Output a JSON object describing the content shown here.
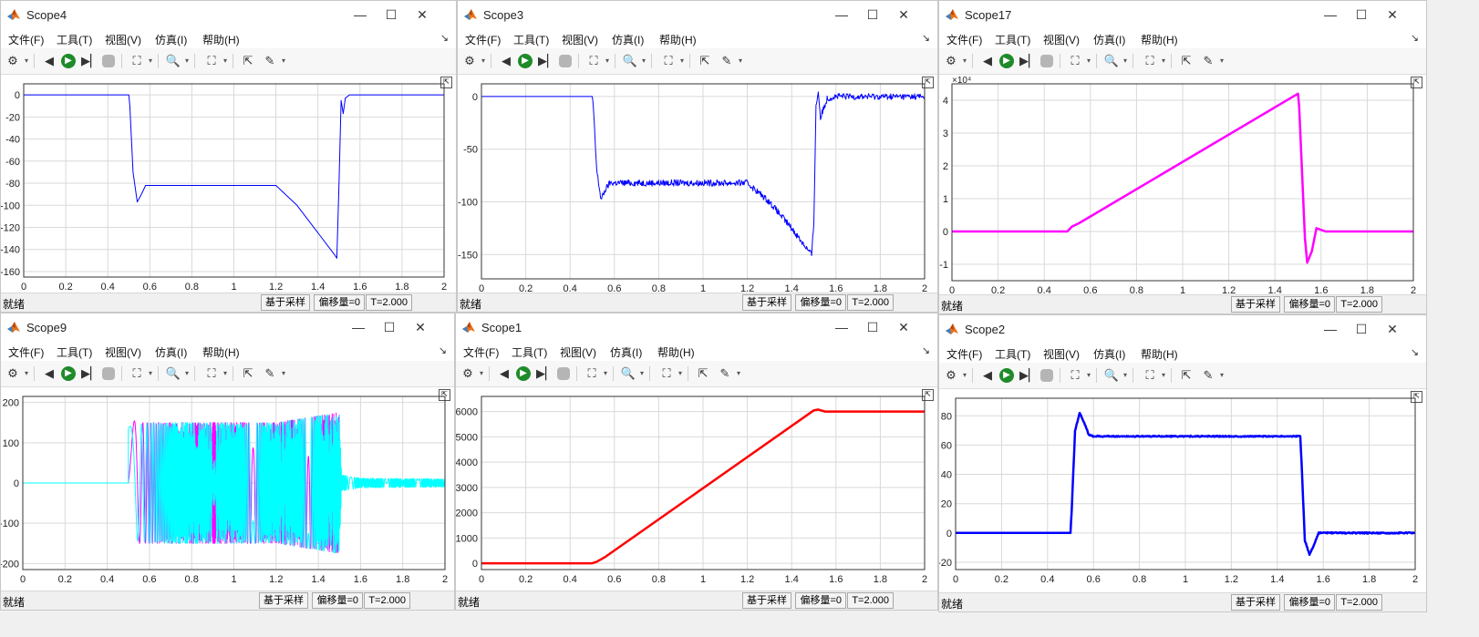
{
  "menu": [
    "文件(F)",
    "工具(T)",
    "视图(V)",
    "仿真(I)",
    "帮助(H)"
  ],
  "status": {
    "ready": "就绪",
    "mode": "基于采样",
    "offset": "偏移量=0",
    "time": "T=2.000"
  },
  "windows": [
    {
      "id": "scope4",
      "title": "Scope4",
      "chart_data": {
        "type": "line",
        "xlim": [
          0,
          2
        ],
        "ylim": [
          -165,
          10
        ],
        "xticks": [
          "0",
          "0.2",
          "0.4",
          "0.6",
          "0.8",
          "1",
          "1.2",
          "1.4",
          "1.6",
          "1.8",
          "2"
        ],
        "yticks": [
          {
            "v": 0,
            "l": "0"
          },
          {
            "v": -20,
            "l": "-20"
          },
          {
            "v": -40,
            "l": "-40"
          },
          {
            "v": -60,
            "l": "-60"
          },
          {
            "v": -80,
            "l": "-80"
          },
          {
            "v": -100,
            "l": "-100"
          },
          {
            "v": -120,
            "l": "-120"
          },
          {
            "v": -140,
            "l": "-140"
          },
          {
            "v": -160,
            "l": "-160"
          }
        ],
        "exponent": "",
        "grid": true,
        "series": [
          {
            "color": "#0000ff",
            "width": 1,
            "noise": 0,
            "x": [
              0,
              0.5,
              0.505,
              0.52,
              0.54,
              0.56,
              0.58,
              0.6,
              1.2,
              1.3,
              1.4,
              1.48,
              1.49,
              1.5,
              1.51,
              1.52,
              1.53,
              1.55,
              1.6,
              2.0
            ],
            "y": [
              0,
              0,
              -10,
              -70,
              -97,
              -90,
              -82,
              -82,
              -82,
              -100,
              -125,
              -145,
              -148,
              -80,
              -5,
              -17,
              -3,
              0,
              0,
              0
            ]
          }
        ]
      }
    },
    {
      "id": "scope3",
      "title": "Scope3",
      "chart_data": {
        "type": "line",
        "xlim": [
          0,
          2
        ],
        "ylim": [
          -173,
          12
        ],
        "xticks": [
          "0",
          "0.2",
          "0.4",
          "0.6",
          "0.8",
          "1",
          "1.2",
          "1.4",
          "1.6",
          "1.8",
          "2"
        ],
        "yticks": [
          {
            "v": 0,
            "l": "0"
          },
          {
            "v": -50,
            "l": "-50"
          },
          {
            "v": -100,
            "l": "-100"
          },
          {
            "v": -150,
            "l": "-150"
          }
        ],
        "exponent": "",
        "grid": true,
        "series": [
          {
            "color": "#0000ff",
            "width": 1,
            "noise": 3,
            "x": [
              0,
              0.5,
              0.505,
              0.52,
              0.54,
              0.56,
              0.58,
              0.6,
              1.2,
              1.3,
              1.4,
              1.49,
              1.5,
              1.51,
              1.52,
              1.53,
              1.56,
              1.6,
              2.0
            ],
            "y": [
              0,
              0,
              -10,
              -70,
              -98,
              -88,
              -82,
              -82,
              -82,
              -100,
              -125,
              -150,
              -120,
              -10,
              5,
              -20,
              -2,
              0,
              0
            ]
          }
        ]
      }
    },
    {
      "id": "scope17",
      "title": "Scope17",
      "chart_data": {
        "type": "line",
        "xlim": [
          0,
          2
        ],
        "ylim": [
          -1.5,
          4.5
        ],
        "xticks": [
          "0",
          "0.2",
          "0.4",
          "0.6",
          "0.8",
          "1",
          "1.2",
          "1.4",
          "1.6",
          "1.8",
          "2"
        ],
        "yticks": [
          {
            "v": 4,
            "l": "4"
          },
          {
            "v": 3,
            "l": "3"
          },
          {
            "v": 2,
            "l": "2"
          },
          {
            "v": 1,
            "l": "1"
          },
          {
            "v": 0,
            "l": "0"
          },
          {
            "v": -1,
            "l": "-1"
          }
        ],
        "exponent": "×10⁴",
        "grid": true,
        "series": [
          {
            "color": "#ff00ff",
            "width": 2.5,
            "noise": 0,
            "x": [
              0,
              0.5,
              0.52,
              0.55,
              1.5,
              1.505,
              1.53,
              1.54,
              1.56,
              1.58,
              1.62,
              2.0
            ],
            "y": [
              0,
              0,
              0.15,
              0.25,
              4.2,
              3.8,
              -0.2,
              -0.95,
              -0.6,
              0.1,
              0,
              0
            ]
          }
        ]
      }
    },
    {
      "id": "scope9",
      "title": "Scope9",
      "chart_data": {
        "type": "line",
        "xlim": [
          0,
          2
        ],
        "ylim": [
          -215,
          215
        ],
        "xticks": [
          "0",
          "0.2",
          "0.4",
          "0.6",
          "0.8",
          "1",
          "1.2",
          "1.4",
          "1.6",
          "1.8",
          "2"
        ],
        "yticks": [
          {
            "v": 200,
            "l": "200"
          },
          {
            "v": 100,
            "l": "100"
          },
          {
            "v": 0,
            "l": "0"
          },
          {
            "v": -100,
            "l": "-100"
          },
          {
            "v": -200,
            "l": "-200"
          }
        ],
        "exponent": "",
        "grid": true,
        "series": [
          {
            "color": "#ff00ff",
            "width": 1,
            "oscillation": true,
            "x0": 0.5,
            "x1": 1.5,
            "amp": [
              [
                0.5,
                160
              ],
              [
                0.55,
                150
              ],
              [
                1.2,
                150
              ],
              [
                1.5,
                175
              ]
            ]
          },
          {
            "color": "#00ffff",
            "width": 1,
            "oscillation": true,
            "x0": 0.5,
            "x1": 2.0,
            "amp": [
              [
                0.5,
                140
              ],
              [
                0.6,
                150
              ],
              [
                1.2,
                150
              ],
              [
                1.5,
                175
              ],
              [
                1.51,
                20
              ],
              [
                1.6,
                12
              ],
              [
                2.0,
                10
              ]
            ]
          }
        ]
      }
    },
    {
      "id": "scope1",
      "title": "Scope1",
      "chart_data": {
        "type": "line",
        "xlim": [
          0,
          2
        ],
        "ylim": [
          -250,
          6600
        ],
        "xticks": [
          "0",
          "0.2",
          "0.4",
          "0.6",
          "0.8",
          "1",
          "1.2",
          "1.4",
          "1.6",
          "1.8",
          "2"
        ],
        "yticks": [
          {
            "v": 6000,
            "l": "6000"
          },
          {
            "v": 5000,
            "l": "5000"
          },
          {
            "v": 4000,
            "l": "4000"
          },
          {
            "v": 3000,
            "l": "3000"
          },
          {
            "v": 2000,
            "l": "2000"
          },
          {
            "v": 1000,
            "l": "1000"
          },
          {
            "v": 0,
            "l": "0"
          }
        ],
        "exponent": "",
        "grid": true,
        "series": [
          {
            "color": "#ff0000",
            "width": 2.5,
            "noise": 0,
            "x": [
              0,
              0.5,
              0.52,
              0.56,
              1.5,
              1.52,
              1.55,
              2.0
            ],
            "y": [
              0,
              0,
              60,
              260,
              6050,
              6080,
              6000,
              6000
            ]
          }
        ]
      }
    },
    {
      "id": "scope2",
      "title": "Scope2",
      "chart_data": {
        "type": "line",
        "xlim": [
          0,
          2
        ],
        "ylim": [
          -25,
          92
        ],
        "xticks": [
          "0",
          "0.2",
          "0.4",
          "0.6",
          "0.8",
          "1",
          "1.2",
          "1.4",
          "1.6",
          "1.8",
          "2"
        ],
        "yticks": [
          {
            "v": 80,
            "l": "80"
          },
          {
            "v": 60,
            "l": "60"
          },
          {
            "v": 40,
            "l": "40"
          },
          {
            "v": 20,
            "l": "20"
          },
          {
            "v": 0,
            "l": "0"
          },
          {
            "v": -20,
            "l": "-20"
          }
        ],
        "exponent": "",
        "grid": true,
        "series": [
          {
            "color": "#0000ff",
            "width": 2.5,
            "noise": 0.4,
            "x": [
              0,
              0.5,
              0.505,
              0.52,
              0.54,
              0.56,
              0.58,
              0.6,
              0.62,
              1.5,
              1.505,
              1.52,
              1.54,
              1.56,
              1.58,
              1.62,
              2.0
            ],
            "y": [
              0,
              0,
              15,
              70,
              82,
              75,
              67,
              66,
              66,
              66,
              50,
              -5,
              -15,
              -8,
              0,
              0,
              0
            ]
          }
        ]
      }
    }
  ]
}
